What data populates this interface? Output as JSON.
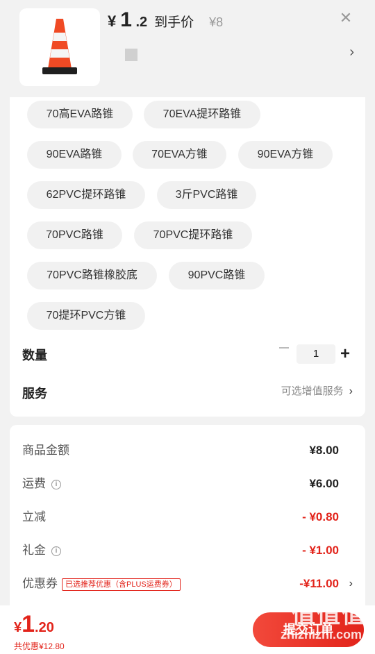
{
  "product": {
    "price_yen": "¥",
    "price_int": "1",
    "price_dec": ".2",
    "price_label": "到手价",
    "original_price": "¥8"
  },
  "options": [
    "70高EVA路锥",
    "70EVA提环路锥",
    "90EVA路锥",
    "70EVA方锥",
    "90EVA方锥",
    "62PVC提环路锥",
    "3斤PVC路锥",
    "70PVC路锥",
    "70PVC提环路锥",
    "70PVC路锥橡胶底",
    "90PVC路锥",
    "70提环PVC方锥"
  ],
  "quantity": {
    "label": "数量",
    "value": "1"
  },
  "service": {
    "label": "服务",
    "value": "可选增值服务"
  },
  "summary": {
    "goods_label": "商品金额",
    "goods_value": "¥8.00",
    "freight_label": "运费",
    "freight_value": "¥6.00",
    "instant_label": "立减",
    "instant_value": "- ¥0.80",
    "gift_label": "礼金",
    "gift_value": "- ¥1.00",
    "coupon_label": "优惠券",
    "coupon_tag": "已选推荐优惠（含PLUS运费券）",
    "coupon_value": "-¥11.00"
  },
  "footer": {
    "total_yen": "¥",
    "total_int": "1",
    "total_dec": ".20",
    "total_discount": "共优惠¥12.80",
    "submit_label": "提交订单"
  },
  "watermark": {
    "top": "值值值",
    "bottom": "zhizhizhi.com"
  },
  "colors": {
    "accent_red": "#e2231a",
    "cone_orange": "#f04a24"
  },
  "icons": {
    "close": "close-icon",
    "chevron": "chevron-right-icon",
    "info": "info-icon"
  }
}
